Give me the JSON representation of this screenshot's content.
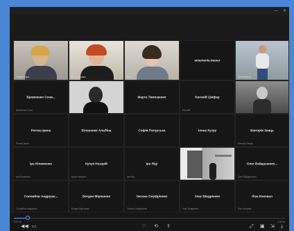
{
  "window": {
    "minimize_glyph": "—",
    "close_glyph": "✕"
  },
  "tiles": [
    {
      "kind": "video",
      "sub": "Ульяна Тара",
      "scene": "blonde-woman",
      "icon": "participant-video"
    },
    {
      "kind": "video",
      "sub": "Юлия Гвоздик",
      "scene": "redhead-woman",
      "icon": "participant-video"
    },
    {
      "kind": "video",
      "sub": "Настя",
      "scene": "dark-hair-woman",
      "icon": "participant-video"
    },
    {
      "kind": "name",
      "name": "anastasiia.masur",
      "sub": ""
    },
    {
      "kind": "video",
      "sub": "Юлия Курчак",
      "scene": "standing-man",
      "icon": "participant-video"
    },
    {
      "kind": "name",
      "name": "Бровченко Соня...",
      "sub": "Бровченко Соня"
    },
    {
      "kind": "video",
      "sub": "",
      "scene": "bw-portrait",
      "icon": "participant-video"
    },
    {
      "kind": "name",
      "name": "Марта Тимошенко",
      "sub": ""
    },
    {
      "kind": "name",
      "name": "Євгеній Шифер",
      "sub": "Євгеній"
    },
    {
      "kind": "video",
      "sub": "",
      "scene": "mirror-selfie",
      "icon": "participant-video"
    },
    {
      "kind": "name",
      "name": "Рогоза Ірина",
      "sub": "Рогоза Ірина"
    },
    {
      "kind": "name",
      "name": "Біланенко Альбіна",
      "sub": ""
    },
    {
      "kind": "name",
      "name": "Софія Погурська",
      "sub": ""
    },
    {
      "kind": "name",
      "name": "Ілона Кузур",
      "sub": ""
    },
    {
      "kind": "name",
      "name": "Вікторія Заяць",
      "sub": "Вікторія Заяць"
    },
    {
      "kind": "name",
      "name": "Іра Юхименко",
      "sub": "Іра Юхименко"
    },
    {
      "kind": "name",
      "name": "Кучук Назарій",
      "sub": "Кучук Назарій"
    },
    {
      "kind": "name",
      "name": "Іра Яцу",
      "sub": "Іра Яцу"
    },
    {
      "kind": "video",
      "sub": "",
      "scene": "bw-room",
      "icon": "participant-video"
    },
    {
      "kind": "name",
      "name": "Олег Вайдашенко...",
      "sub": "Олег Вайдашенко"
    },
    {
      "kind": "name",
      "name": "Соловйов Андрушк...",
      "sub": "Соловйов Андрушко"
    },
    {
      "kind": "name",
      "name": "Богдан Мірошник",
      "sub": "Богдан Мірошник"
    },
    {
      "kind": "name",
      "name": "Оксана Онуфрієнко",
      "sub": "Оксана Онуфрієнко"
    },
    {
      "kind": "name",
      "name": "Улас Віндрієнко",
      "sub": "Улас Віндрієнко"
    },
    {
      "kind": "name",
      "name": "Ліза Коновал",
      "sub": "Ліза Коновал"
    }
  ],
  "playback": {
    "progress": 0.05,
    "elapsed": "0:03:15",
    "remaining": "-1:34:10"
  },
  "controls": {
    "left": [
      "◀◀",
      "▭"
    ],
    "center": [
      "♡",
      "⟲",
      "⇪"
    ],
    "right": [
      "⤢",
      "▣",
      "⇲",
      "⤓"
    ]
  },
  "colors": {
    "accent": "#5aa0ff",
    "frame": "#4a86d6"
  }
}
